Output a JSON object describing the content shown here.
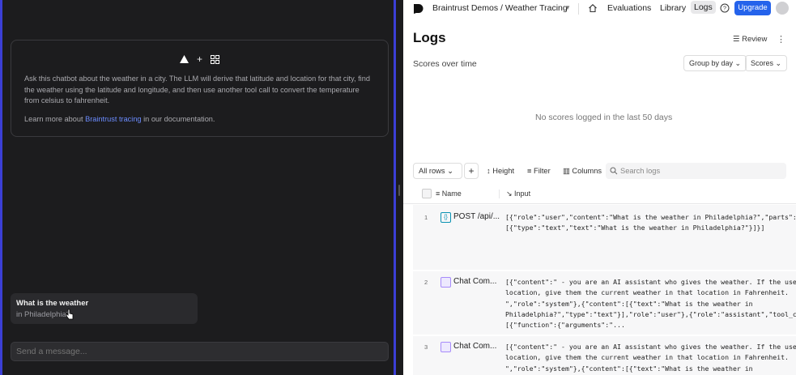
{
  "chat": {
    "description": "Ask this chatbot about the weather in a city. The LLM will derive that latitude and location for that city, find the weather using the latitude and longitude, and then use another tool call to convert the temperature from celsius to fahrenheit.",
    "learn_prefix": "Learn more about",
    "learn_link": "Braintrust tracing",
    "learn_suffix": "in our documentation.",
    "logo_plus": "+",
    "suggestion_title": "What is the weather",
    "suggestion_sub": "in Philadelphia?",
    "input_placeholder": "Send a message..."
  },
  "topbar": {
    "project": "Braintrust Demos / Weather Tracing",
    "nav": [
      "Evaluations",
      "Library",
      "Logs"
    ],
    "upgrade": "Upgrade"
  },
  "logs": {
    "title": "Logs",
    "review": "Review",
    "scores_over_time": "Scores over time",
    "group_by": "Group by day",
    "scores": "Scores",
    "empty": "No scores logged in the last 50 days",
    "toolbar": {
      "all_rows": "All rows",
      "height": "Height",
      "filter": "Filter",
      "columns": "Columns",
      "search_placeholder": "Search logs"
    },
    "columns": [
      "Name",
      "Input"
    ],
    "rows": [
      {
        "num": "1",
        "name": "POST /api/...",
        "input": "[{\"role\":\"user\",\"content\":\"What is the weather in Philadelphia?\",\"parts\":\n[{\"type\":\"text\",\"text\":\"What is the weather in Philadelphia?\"}]}]"
      },
      {
        "num": "2",
        "name": "Chat Com...",
        "input": "[{\"content\":\" - you are an AI assistant who gives the weather. If the user g\nlocation, give them the current weather in that location in Fahrenheit.\n\",\"role\":\"system\"},{\"content\":[{\"text\":\"What is the weather in\nPhiladelphia?\",\"type\":\"text\"}],\"role\":\"user\"},{\"role\":\"assistant\",\"tool_call\n[{\"function\":{\"arguments\":\"..."
      },
      {
        "num": "3",
        "name": "Chat Com...",
        "input": "[{\"content\":\" - you are an AI assistant who gives the weather. If the user g\nlocation, give them the current weather in that location in Fahrenheit.\n\",\"role\":\"system\"},{\"content\":[{\"text\":\"What is the weather in"
      }
    ]
  },
  "colors": {
    "accent": "#2563eb",
    "panel_border": "#3b3fd6",
    "dark_bg": "#1c1c1e",
    "link": "#6b8cff"
  }
}
